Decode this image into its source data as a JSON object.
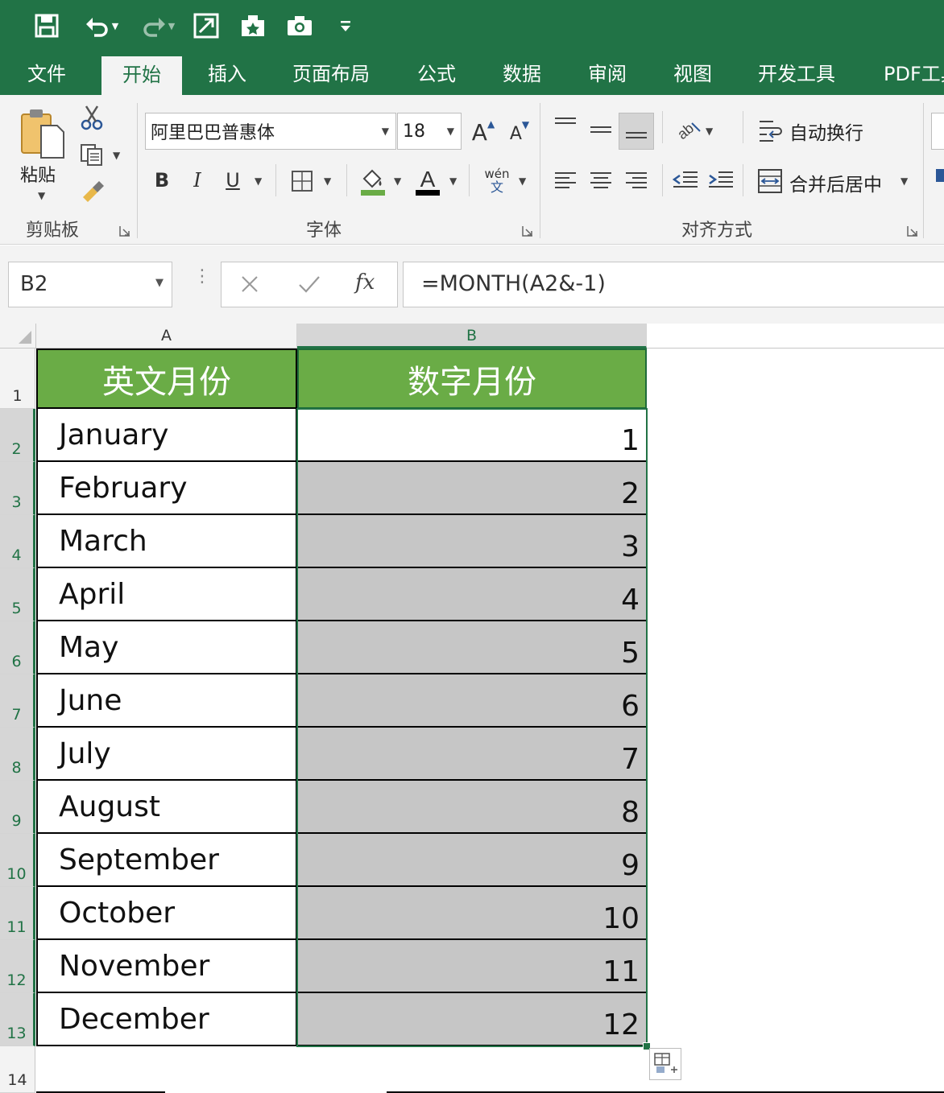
{
  "quick_access": {
    "icons": [
      "save-icon",
      "undo-icon",
      "redo-icon",
      "fit-to-page-icon",
      "favorites-icon",
      "camera-icon",
      "customize-qat-icon"
    ]
  },
  "tabs": [
    "文件",
    "开始",
    "插入",
    "页面布局",
    "公式",
    "数据",
    "审阅",
    "视图",
    "开发工具",
    "PDF工具"
  ],
  "active_tab": "开始",
  "ribbon": {
    "clipboard": {
      "paste_label": "粘贴",
      "group_label": "剪贴板"
    },
    "font": {
      "font_name": "阿里巴巴普惠体",
      "font_size": "18",
      "group_label": "字体",
      "phonetic": "wén",
      "phonetic_char": "文"
    },
    "alignment": {
      "wrap_text": "自动换行",
      "merge_center": "合并后居中",
      "group_label": "对齐方式"
    }
  },
  "formula_bar": {
    "name_box": "B2",
    "formula": "=MONTH(A2&-1)",
    "fx": "fx"
  },
  "columns": [
    "A",
    "B"
  ],
  "rows": [
    "1",
    "2",
    "3",
    "4",
    "5",
    "6",
    "7",
    "8",
    "9",
    "10",
    "11",
    "12",
    "13",
    "14"
  ],
  "table": {
    "headers": [
      "英文月份",
      "数字月份"
    ],
    "months": [
      "January",
      "February",
      "March",
      "April",
      "May",
      "June",
      "July",
      "August",
      "September",
      "October",
      "November",
      "December"
    ],
    "numbers": [
      "1",
      "2",
      "3",
      "4",
      "5",
      "6",
      "7",
      "8",
      "9",
      "10",
      "11",
      "12"
    ]
  },
  "colors": {
    "excel_green": "#217346",
    "header_fill": "#6aac46",
    "selection_fill": "#c6c6c6"
  }
}
